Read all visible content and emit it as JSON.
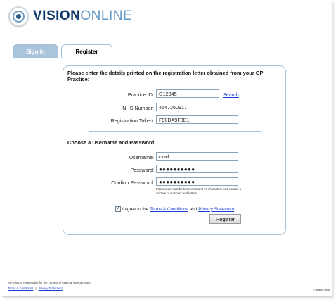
{
  "brand": {
    "vision": "VISION",
    "online": "ONLINE"
  },
  "tabs": [
    {
      "label": "Sign In",
      "active": false
    },
    {
      "label": "Register",
      "active": true
    }
  ],
  "form": {
    "intro_heading": "Please enter the details printed on the registration letter obtained from your GP Practice:",
    "practice_id": {
      "label": "Practice ID:",
      "value": "G12345"
    },
    "search_link": "Search",
    "nhs_number": {
      "label": "NHS Number:",
      "value": "4647260917"
    },
    "registration_token": {
      "label": "Registration Token:",
      "value": "F90DA9F8B1"
    },
    "credentials_heading": "Choose a Username and Password:",
    "username": {
      "label": "Username:",
      "value": "ckail"
    },
    "password": {
      "label": "Password:",
      "value": "●●●●●●●●●●"
    },
    "confirm_password": {
      "label": "Confirm Password:",
      "value": "●●●●●●●●●●"
    },
    "password_hint": "Passwords must be between 8 and 16 characters and contain a mixture of numbers and letters",
    "agree": {
      "checked": true,
      "check_mark": "✓",
      "prefix": "I agree to the",
      "terms_link": "Terms & Conditions",
      "and": "and",
      "privacy_link": "Privacy Statement"
    },
    "register_button": "Register"
  },
  "footer": {
    "disclaimer": "INPS is not responsible for the content of external internet sites.",
    "terms_link": "Terms & Conditions",
    "separator": "|",
    "privacy_link": "Privacy Statement",
    "copyright": "© INPS 2009"
  },
  "colors": {
    "brand_dark": "#10396b",
    "brand_light": "#5f97c8",
    "tab_inactive": "#a9c4db",
    "panel_border": "#a7c3d9",
    "link": "#1a3fd6"
  }
}
